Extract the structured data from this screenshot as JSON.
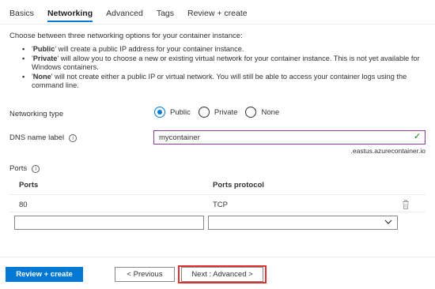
{
  "tabs": [
    {
      "label": "Basics"
    },
    {
      "label": "Networking"
    },
    {
      "label": "Advanced"
    },
    {
      "label": "Tags"
    },
    {
      "label": "Review + create"
    }
  ],
  "active_tab": "Networking",
  "intro": "Choose between three networking options for your container instance:",
  "bullets": [
    {
      "name": "Public",
      "text": " will create a public IP address for your container instance."
    },
    {
      "name": "Private",
      "text": " will allow you to choose a new or existing virtual network for your container instance. This is not yet available for Windows containers."
    },
    {
      "name": "None",
      "text": " will not create either a public IP or virtual network. You will still be able to access your container logs using the command line."
    }
  ],
  "networking_type": {
    "label": "Networking type",
    "options": [
      "Public",
      "Private",
      "None"
    ],
    "selected": "Public"
  },
  "dns": {
    "label": "DNS name label",
    "value": "mycontainer",
    "suffix": ".eastus.azurecontainer.io",
    "valid": true
  },
  "ports": {
    "label": "Ports",
    "columns": [
      "Ports",
      "Ports protocol"
    ],
    "rows": [
      {
        "port": "80",
        "protocol": "TCP"
      }
    ],
    "new_port_value": "",
    "new_protocol_value": ""
  },
  "footer": {
    "review_label": "Review + create",
    "previous_label": "< Previous",
    "next_label": "Next : Advanced >"
  },
  "colors": {
    "accent": "#0078d4",
    "valid": "#107c10",
    "highlight": "#e03131",
    "input_focus": "#8a3b9b"
  }
}
